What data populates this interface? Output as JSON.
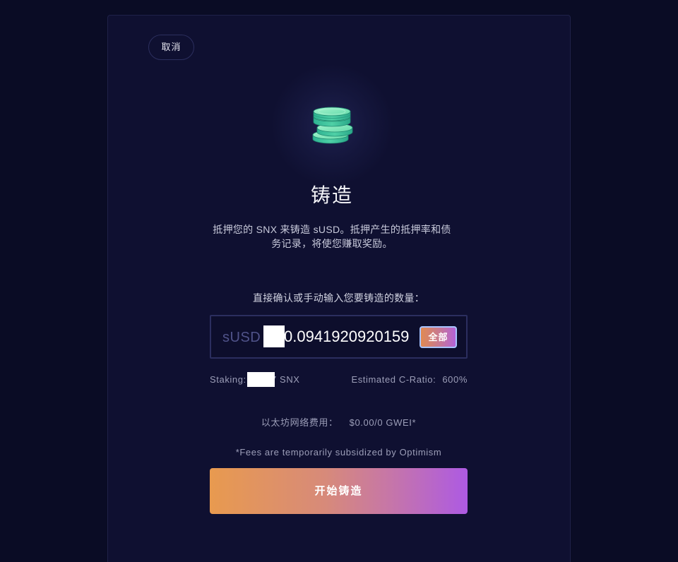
{
  "cancel_label": "取消",
  "title": "铸造",
  "description": {
    "line1": "抵押您的 SNX 来铸造 sUSD。抵押产生的抵押率和债",
    "line2": "务记录，将使您赚取奖励。"
  },
  "prompt": "直接确认或手动输入您要铸造的数量：",
  "amount_input": {
    "currency": "sUSD",
    "value": "0.0941920920159",
    "max_label": "全部"
  },
  "staking": {
    "label": "Staking:",
    "value": "7 SNX"
  },
  "c_ratio": {
    "label": "Estimated C-Ratio:",
    "value": "600%"
  },
  "gas": {
    "label": "以太坊网络费用：",
    "value": "$0.00/0 GWEI*"
  },
  "fee_note": "*Fees are temporarily subsidized by Optimism",
  "submit_label": "开始铸造",
  "icons": {
    "hero": "coins-stack-icon"
  },
  "colors": {
    "background": "#0a0c25",
    "panel": "#0f1031",
    "muted_text": "#9c9eb8",
    "gradient_start": "#e89a4f",
    "gradient_end": "#ad5ae3",
    "coin_face": "#8ef0c0",
    "coin_edge": "#3cc49c"
  }
}
